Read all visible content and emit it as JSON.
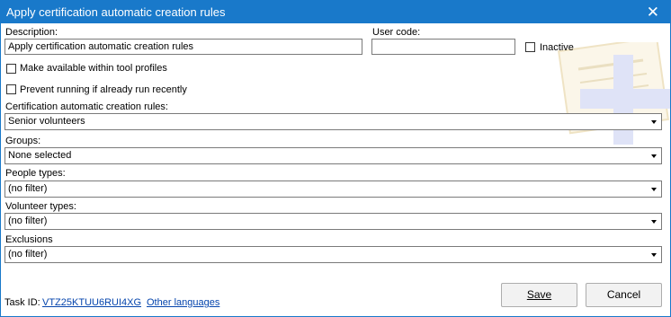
{
  "window": {
    "title": "Apply certification automatic creation rules"
  },
  "form": {
    "description_label": "Description:",
    "description_value": "Apply certification automatic creation rules",
    "user_code_label": "User code:",
    "user_code_value": "",
    "inactive_label": "Inactive",
    "make_available_label": "Make available within tool profiles",
    "prevent_running_label": "Prevent running if already run recently",
    "rules_label": "Certification automatic creation rules:",
    "rules_value": "Senior volunteers",
    "groups_label": "Groups:",
    "groups_value": "None selected",
    "people_types_label": "People types:",
    "people_types_value": "(no filter)",
    "volunteer_types_label": "Volunteer types:",
    "volunteer_types_value": "(no filter)",
    "exclusions_label": "Exclusions",
    "exclusions_value": "(no filter)"
  },
  "footer": {
    "task_id_label": "Task ID:",
    "task_id_value": "VTZ25KTUU6RUI4XG",
    "other_languages": "Other languages",
    "save": "Save",
    "cancel": "Cancel"
  },
  "icons": {
    "close": "close-icon",
    "dropdown": "chevron-down-icon",
    "watermark": "certificate-watermark-icon"
  }
}
